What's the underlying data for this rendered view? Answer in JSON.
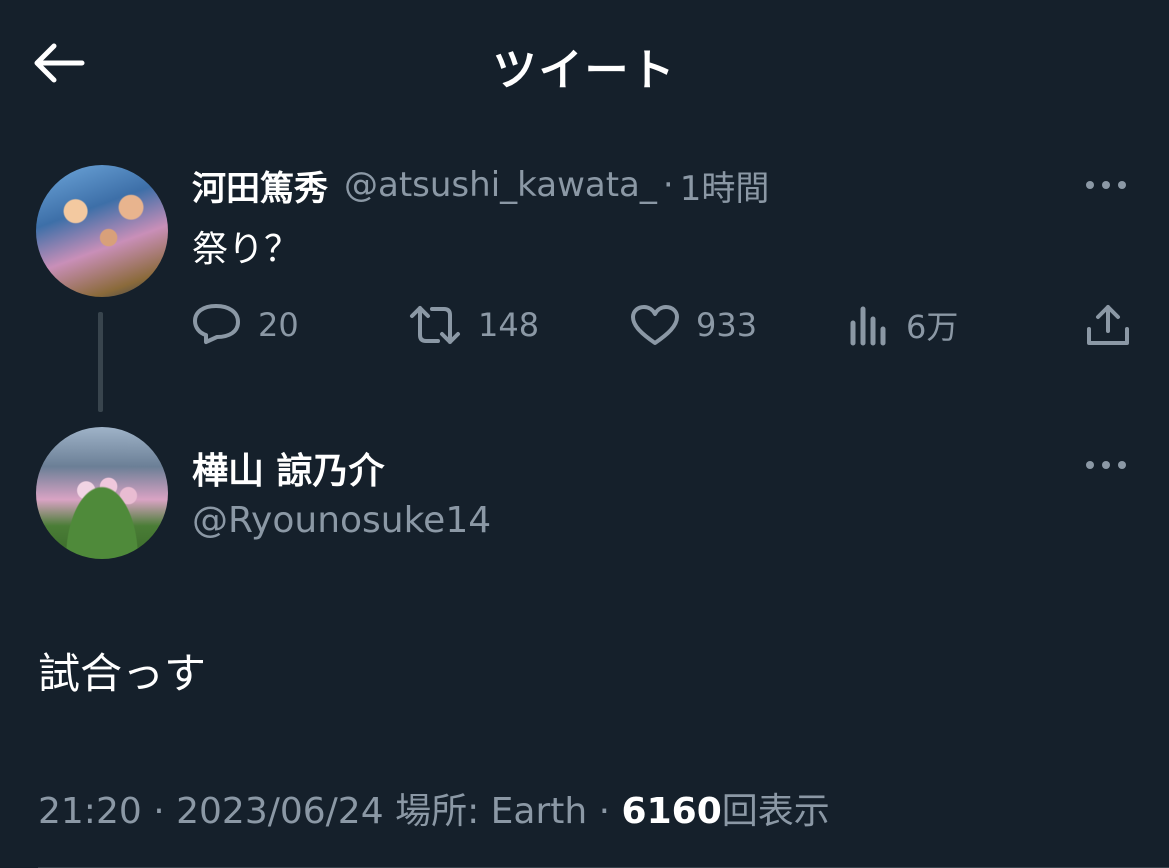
{
  "header": {
    "title": "ツイート"
  },
  "parent_tweet": {
    "display_name": "河田篤秀",
    "handle": "@atsushi_kawata_",
    "separator": "·",
    "time": "1時間",
    "text": "祭り？",
    "replies": "20",
    "retweets": "148",
    "likes": "933",
    "views": "6万"
  },
  "main_tweet": {
    "display_name": "樺山 諒乃介",
    "handle": "@Ryounosuke14",
    "text": "試合っす",
    "time": "21:20",
    "date": "2023/06/24",
    "location": "場所: Earth",
    "view_count": "6160",
    "view_label": "回表示",
    "separator": "·"
  },
  "colors": {
    "background": "#15202b",
    "secondary_text": "#8b98a5",
    "primary_text": "#ffffff"
  },
  "icons": [
    "back-arrow-icon",
    "more-icon",
    "reply-icon",
    "retweet-icon",
    "like-icon",
    "views-icon",
    "share-icon"
  ]
}
